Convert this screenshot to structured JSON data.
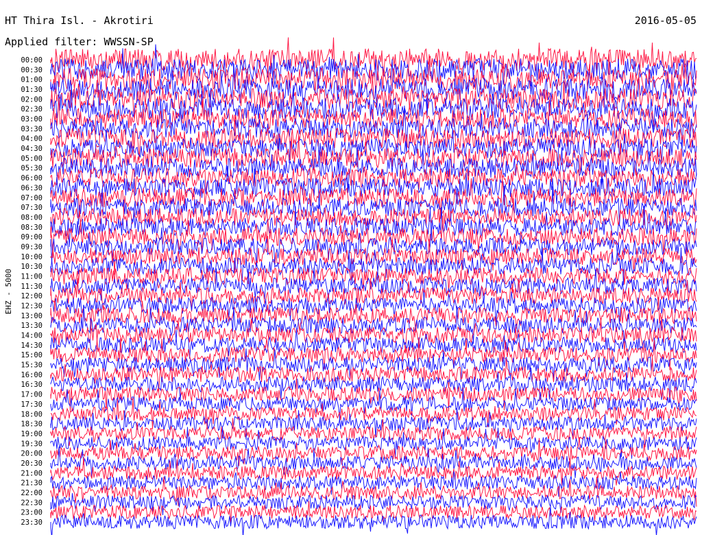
{
  "header": {
    "station": "HT Thira Isl. - Akrotiri",
    "date": "2016-05-05",
    "filter": "Applied filter: WWSSN-SP"
  },
  "chart_data": {
    "type": "line",
    "title": "HT Thira Isl. - Akrotiri",
    "ylabel": "EHZ - 5000",
    "colors": [
      "#ff1744",
      "#1a1aff"
    ],
    "rows": [
      {
        "time": "00:00",
        "color": "#ff1744",
        "level": 1.0
      },
      {
        "time": "00:30",
        "color": "#1a1aff",
        "level": 1.0
      },
      {
        "time": "01:00",
        "color": "#ff1744",
        "level": 1.0
      },
      {
        "time": "01:30",
        "color": "#1a1aff",
        "level": 1.0
      },
      {
        "time": "02:00",
        "color": "#ff1744",
        "level": 0.95
      },
      {
        "time": "02:30",
        "color": "#1a1aff",
        "level": 0.95
      },
      {
        "time": "03:00",
        "color": "#ff1744",
        "level": 0.9
      },
      {
        "time": "03:30",
        "color": "#1a1aff",
        "level": 0.9
      },
      {
        "time": "04:00",
        "color": "#ff1744",
        "level": 0.9
      },
      {
        "time": "04:30",
        "color": "#1a1aff",
        "level": 0.85
      },
      {
        "time": "05:00",
        "color": "#ff1744",
        "level": 0.85
      },
      {
        "time": "05:30",
        "color": "#1a1aff",
        "level": 0.85
      },
      {
        "time": "06:00",
        "color": "#ff1744",
        "level": 0.8
      },
      {
        "time": "06:30",
        "color": "#1a1aff",
        "level": 0.8
      },
      {
        "time": "07:00",
        "color": "#ff1744",
        "level": 0.8
      },
      {
        "time": "07:30",
        "color": "#1a1aff",
        "level": 0.8
      },
      {
        "time": "08:00",
        "color": "#ff1744",
        "level": 0.75
      },
      {
        "time": "08:30",
        "color": "#1a1aff",
        "level": 0.75
      },
      {
        "time": "09:00",
        "color": "#ff1744",
        "level": 0.75
      },
      {
        "time": "09:30",
        "color": "#1a1aff",
        "level": 0.7
      },
      {
        "time": "10:00",
        "color": "#ff1744",
        "level": 0.7
      },
      {
        "time": "10:30",
        "color": "#1a1aff",
        "level": 0.7
      },
      {
        "time": "11:00",
        "color": "#ff1744",
        "level": 0.7
      },
      {
        "time": "11:30",
        "color": "#1a1aff",
        "level": 0.65
      },
      {
        "time": "12:00",
        "color": "#ff1744",
        "level": 0.65
      },
      {
        "time": "12:30",
        "color": "#1a1aff",
        "level": 0.65
      },
      {
        "time": "13:00",
        "color": "#ff1744",
        "level": 0.65
      },
      {
        "time": "13:30",
        "color": "#1a1aff",
        "level": 0.65
      },
      {
        "time": "14:00",
        "color": "#ff1744",
        "level": 0.65
      },
      {
        "time": "14:30",
        "color": "#1a1aff",
        "level": 0.6
      },
      {
        "time": "15:00",
        "color": "#ff1744",
        "level": 0.6
      },
      {
        "time": "15:30",
        "color": "#1a1aff",
        "level": 0.6
      },
      {
        "time": "16:00",
        "color": "#ff1744",
        "level": 0.6
      },
      {
        "time": "16:30",
        "color": "#1a1aff",
        "level": 0.6
      },
      {
        "time": "17:00",
        "color": "#ff1744",
        "level": 0.55
      },
      {
        "time": "17:30",
        "color": "#1a1aff",
        "level": 0.55
      },
      {
        "time": "18:00",
        "color": "#ff1744",
        "level": 0.5
      },
      {
        "time": "18:30",
        "color": "#1a1aff",
        "level": 0.5
      },
      {
        "time": "19:00",
        "color": "#ff1744",
        "level": 0.5
      },
      {
        "time": "19:30",
        "color": "#1a1aff",
        "level": 0.5
      },
      {
        "time": "20:00",
        "color": "#ff1744",
        "level": 0.5
      },
      {
        "time": "20:30",
        "color": "#1a1aff",
        "level": 0.5
      },
      {
        "time": "21:00",
        "color": "#ff1744",
        "level": 0.5
      },
      {
        "time": "21:30",
        "color": "#1a1aff",
        "level": 0.5
      },
      {
        "time": "22:00",
        "color": "#ff1744",
        "level": 0.5
      },
      {
        "time": "22:30",
        "color": "#1a1aff",
        "level": 0.5
      },
      {
        "time": "23:00",
        "color": "#ff1744",
        "level": 0.5
      },
      {
        "time": "23:30",
        "color": "#1a1aff",
        "level": 0.5
      }
    ]
  }
}
